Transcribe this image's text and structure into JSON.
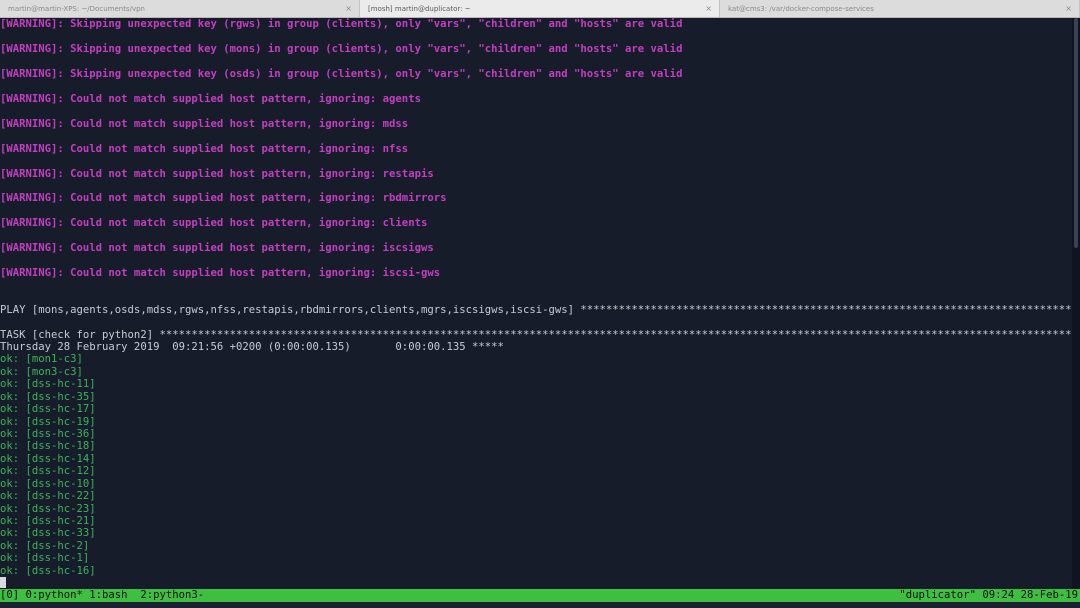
{
  "tabs": [
    {
      "title": "martin@martin-XPS: ~/Documents/vpn",
      "close": "×"
    },
    {
      "title": "[mosh] martin@duplicator: ~",
      "close": "×"
    },
    {
      "title": "kat@cms3: /var/docker-compose-services",
      "close": "×"
    }
  ],
  "terminal": {
    "warnings": [
      "[WARNING]: Skipping unexpected key (rgws) in group (clients), only \"vars\", \"children\" and \"hosts\" are valid",
      "[WARNING]: Skipping unexpected key (mons) in group (clients), only \"vars\", \"children\" and \"hosts\" are valid",
      "[WARNING]: Skipping unexpected key (osds) in group (clients), only \"vars\", \"children\" and \"hosts\" are valid",
      "[WARNING]: Could not match supplied host pattern, ignoring: agents",
      "[WARNING]: Could not match supplied host pattern, ignoring: mdss",
      "[WARNING]: Could not match supplied host pattern, ignoring: nfss",
      "[WARNING]: Could not match supplied host pattern, ignoring: restapis",
      "[WARNING]: Could not match supplied host pattern, ignoring: rbdmirrors",
      "[WARNING]: Could not match supplied host pattern, ignoring: clients",
      "[WARNING]: Could not match supplied host pattern, ignoring: iscsigws",
      "[WARNING]: Could not match supplied host pattern, ignoring: iscsi-gws"
    ],
    "play": "PLAY [mons,agents,osds,mdss,rgws,nfss,restapis,rbdmirrors,clients,mgrs,iscsigws,iscsi-gws] **************************************************************************************************************",
    "task": "TASK [check for python2] ************************************************************************************************************************************************************************************",
    "date": "Thursday 28 February 2019  09:21:56 +0200 (0:00:00.135)       0:00:00.135 *****",
    "ok_lines": [
      "ok: [mon1-c3]",
      "ok: [mon3-c3]",
      "ok: [dss-hc-11]",
      "ok: [dss-hc-35]",
      "ok: [dss-hc-17]",
      "ok: [dss-hc-19]",
      "ok: [dss-hc-36]",
      "ok: [dss-hc-18]",
      "ok: [dss-hc-14]",
      "ok: [dss-hc-12]",
      "ok: [dss-hc-10]",
      "ok: [dss-hc-22]",
      "ok: [dss-hc-23]",
      "ok: [dss-hc-21]",
      "ok: [dss-hc-33]",
      "ok: [dss-hc-2]",
      "ok: [dss-hc-1]",
      "ok: [dss-hc-16]"
    ]
  },
  "status_bar": {
    "windows": "[0] 0:python* 1:bash  2:python3-",
    "host_time": "\"duplicator\" 09:24 28-Feb-19"
  },
  "colors": {
    "background": "#161c2a",
    "warning": "#c33fbf",
    "ok": "#3cb35a",
    "status_bar": "#3fbf3f"
  }
}
